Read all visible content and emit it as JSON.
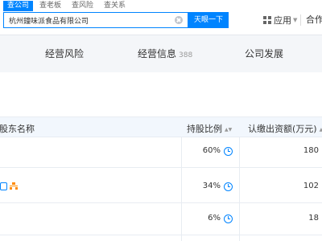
{
  "search": {
    "tabs": [
      "查公司",
      "查老板",
      "查风险",
      "查关系"
    ],
    "active_tab": 0,
    "value": "杭州鐘味派食品有限公司",
    "button_label": "天眼一下"
  },
  "header": {
    "app_label": "应用",
    "coop_label": "合作"
  },
  "section_nav": [
    {
      "label": "经营风险",
      "count": ""
    },
    {
      "label": "经营信息",
      "count": "388"
    },
    {
      "label": "公司发展",
      "count": ""
    }
  ],
  "table": {
    "headers": {
      "shareholder": "股东名称",
      "ratio": "持股比例",
      "capital": "认缴出资额(万元)"
    },
    "rows": [
      {
        "ratio": "60%",
        "capital": "180"
      },
      {
        "ratio": "34%",
        "capital": "102"
      },
      {
        "ratio": "6%",
        "capital": "18"
      }
    ]
  },
  "colors": {
    "accent": "#0084ff",
    "header_bg": "#f2f7fd",
    "nav_bg": "#f4f6f9",
    "badge_orange": "#ff8a00"
  }
}
